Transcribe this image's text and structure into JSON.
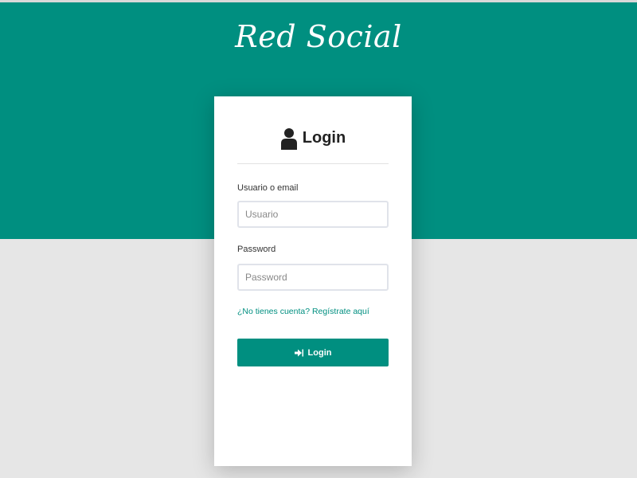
{
  "brand": {
    "title": "Red Social"
  },
  "login_card": {
    "title": "Login",
    "header_icon": "user-icon",
    "username": {
      "label": "Usuario o email",
      "placeholder": "Usuario"
    },
    "password": {
      "label": "Password",
      "placeholder": "Password"
    },
    "register_link": "¿No tienes cuenta? Regístrate aquí",
    "submit": {
      "label": "Login",
      "icon": "sign-in-icon"
    }
  },
  "colors": {
    "accent": "#008f80",
    "background": "#e6e6e6",
    "card": "#ffffff"
  }
}
